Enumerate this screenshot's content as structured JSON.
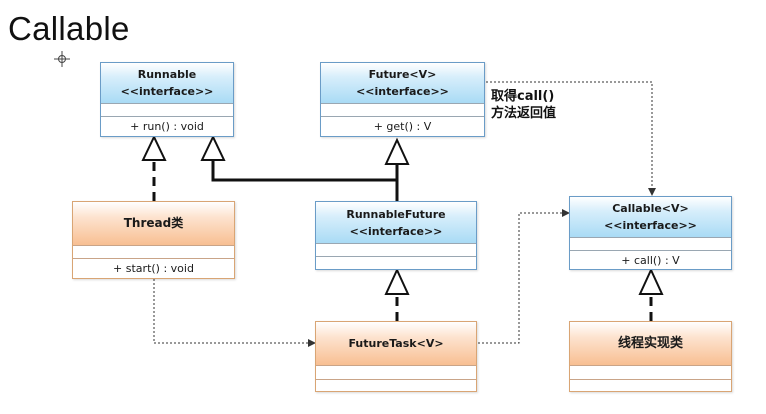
{
  "title": "Callable",
  "note": {
    "line1": "取得call()",
    "line2": "方法返回值"
  },
  "classes": {
    "runnable": {
      "name": "Runnable",
      "stereotype": "<<interface>>",
      "method": "+ run() : void"
    },
    "future": {
      "name": "Future<V>",
      "stereotype": "<<interface>>",
      "method": "+ get() : V"
    },
    "thread": {
      "name": "Thread类",
      "method": "+ start() : void"
    },
    "runnable_future": {
      "name": "RunnableFuture",
      "stereotype": "<<interface>>"
    },
    "callable": {
      "name": "Callable<V>",
      "stereotype": "<<interface>>",
      "method": "+ call() : V"
    },
    "future_task": {
      "name": "FutureTask<V>"
    },
    "impl": {
      "name": "线程实现类"
    }
  },
  "colors": {
    "interface_fill": "#a9dbf5",
    "class_fill": "#f8bf92",
    "interface_border": "#6a9cc7",
    "class_border": "#d9a574"
  }
}
